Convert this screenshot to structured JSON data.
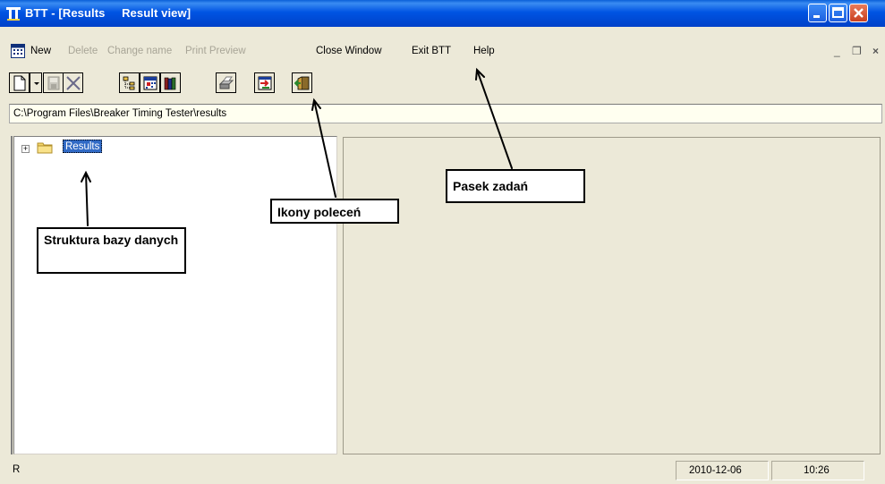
{
  "window": {
    "title": "BTT - [Results     Result view]"
  },
  "menu": {
    "items": [
      {
        "label": "New",
        "enabled": true
      },
      {
        "label": "Delete",
        "enabled": false
      },
      {
        "label": "Change name",
        "enabled": false
      },
      {
        "label": "Print Preview",
        "enabled": false
      },
      {
        "label": "Close Window",
        "enabled": true
      },
      {
        "label": "Exit BTT",
        "enabled": true
      },
      {
        "label": "Help",
        "enabled": true
      }
    ],
    "mdi_controls": [
      "_",
      "❐",
      "×"
    ]
  },
  "toolbar": {
    "icons": [
      "new-file-icon",
      "dropdown-arrow-icon",
      "save-icon",
      "delete-icon",
      "tree-view-icon",
      "calendar-icon",
      "books-icon",
      "printer-icon",
      "export-icon",
      "exit-icon"
    ]
  },
  "path": {
    "value": "C:\\Program Files\\Breaker Timing Tester\\results"
  },
  "tree": {
    "expander": "+",
    "root_label": "Results"
  },
  "status": {
    "left": "R",
    "date": "2010-12-06",
    "time": "10:26"
  },
  "annotations": {
    "database": "Struktura bazy danych",
    "icons": "Ikony poleceń",
    "taskbar": "Pasek zadań"
  },
  "colors": {
    "title_bar": "#0054e3",
    "selection": "#316ac5",
    "face": "#ece9d8"
  }
}
